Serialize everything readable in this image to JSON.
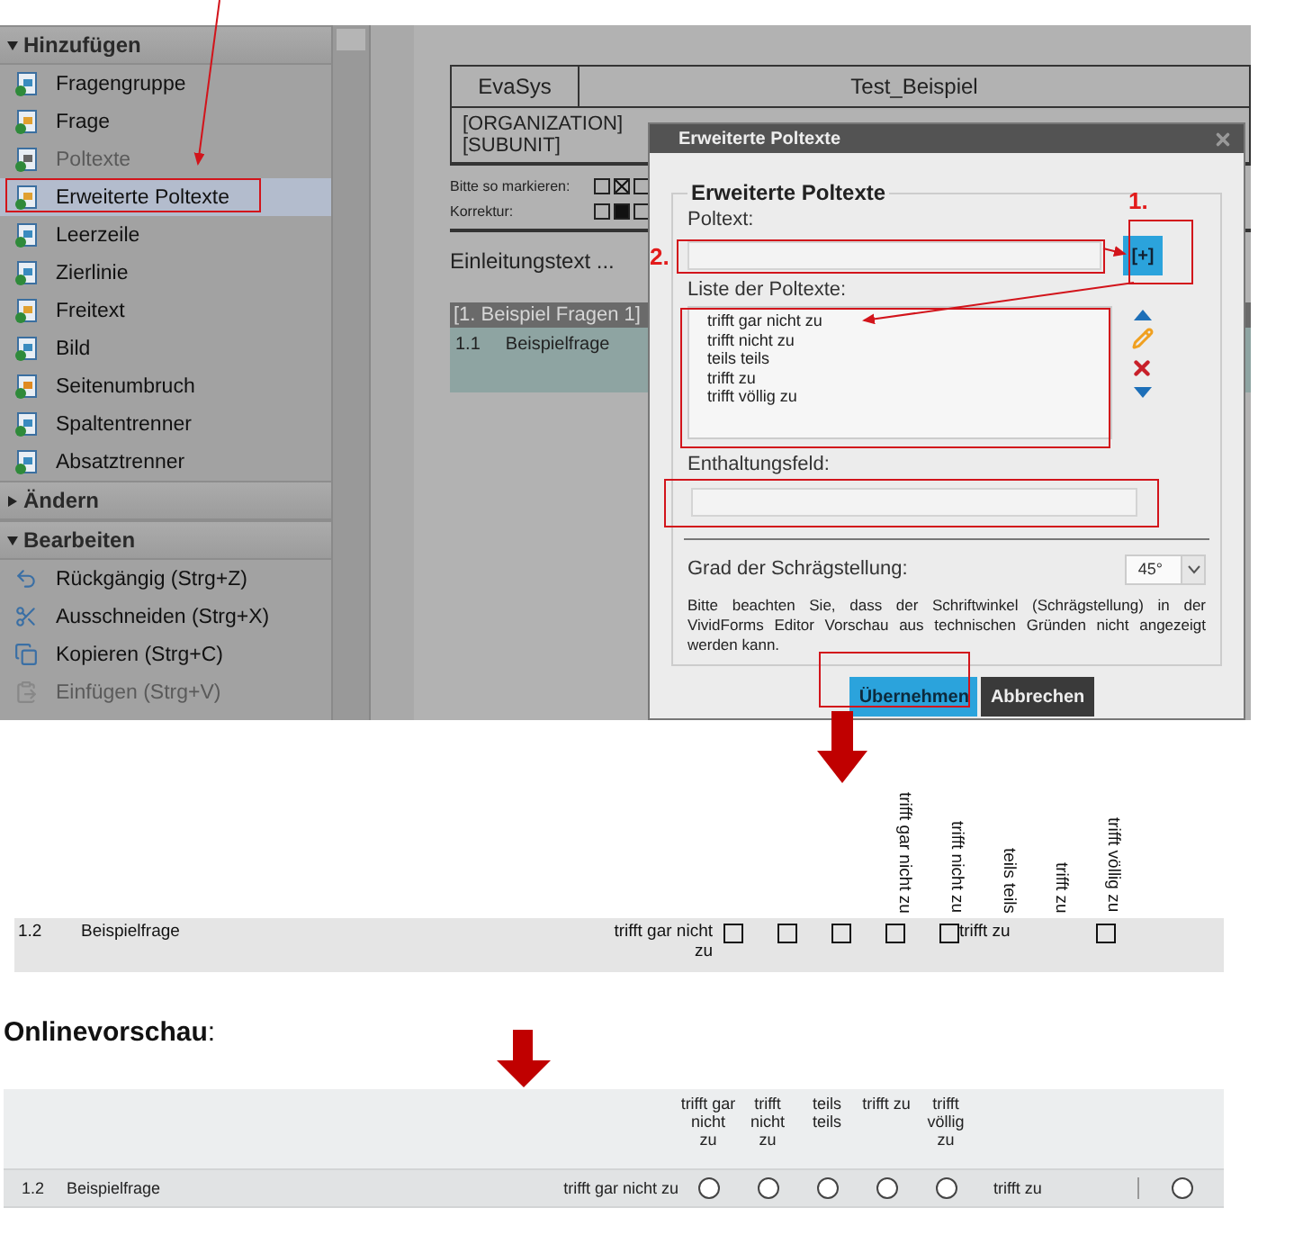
{
  "sidebar": {
    "sections": [
      {
        "title": "Hinzufügen",
        "expanded": true,
        "items": [
          {
            "label": "Fragengruppe",
            "disabled": false,
            "selected": false
          },
          {
            "label": "Frage",
            "disabled": false,
            "selected": false
          },
          {
            "label": "Poltexte",
            "disabled": true,
            "selected": false
          },
          {
            "label": "Erweiterte Poltexte",
            "disabled": false,
            "selected": true
          },
          {
            "label": "Leerzeile",
            "disabled": false,
            "selected": false
          },
          {
            "label": "Zierlinie",
            "disabled": false,
            "selected": false
          },
          {
            "label": "Freitext",
            "disabled": false,
            "selected": false
          },
          {
            "label": "Bild",
            "disabled": false,
            "selected": false
          },
          {
            "label": "Seitenumbruch",
            "disabled": false,
            "selected": false
          },
          {
            "label": "Spaltentrenner",
            "disabled": false,
            "selected": false
          },
          {
            "label": "Absatztrenner",
            "disabled": false,
            "selected": false
          }
        ]
      },
      {
        "title": "Ändern",
        "expanded": false
      },
      {
        "title": "Bearbeiten",
        "expanded": true,
        "items": [
          {
            "label": "Rückgängig (Strg+Z)",
            "disabled": false,
            "selected": false
          },
          {
            "label": "Ausschneiden (Strg+X)",
            "disabled": false,
            "selected": false
          },
          {
            "label": "Kopieren (Strg+C)",
            "disabled": false,
            "selected": false
          },
          {
            "label": "Einfügen (Strg+V)",
            "disabled": true,
            "selected": false
          }
        ]
      }
    ]
  },
  "document": {
    "header_left": "EvaSys",
    "header_right": "Test_Beispiel",
    "organization": "[ORGANIZATION]",
    "subunit": "[SUBUNIT]",
    "mark_rows": [
      {
        "label": "Bitte so markieren:",
        "boxes": [
          {
            "kind": "empty"
          },
          {
            "kind": "crossed"
          },
          {
            "kind": "empty"
          }
        ]
      },
      {
        "label": "Korrektur:",
        "boxes": [
          {
            "kind": "empty"
          },
          {
            "kind": "filled"
          },
          {
            "kind": "empty"
          }
        ]
      }
    ],
    "intro": "Einleitungstext ...",
    "group_title": "[1. Beispiel Fragen 1]",
    "question": {
      "number": "1.1",
      "text": "Beispielfrage"
    }
  },
  "dialog": {
    "title": "Erweiterte Poltexte",
    "section_title": "Erweiterte Poltexte",
    "poltext_label": "Poltext:",
    "add_button": "[+]",
    "list_label": "Liste der Poltexte:",
    "list_items": [
      "trifft gar nicht zu",
      "trifft nicht zu",
      "teils teils",
      "trifft zu",
      "trifft völlig zu"
    ],
    "abstain_label": "Enthaltungsfeld:",
    "angle_label": "Grad der Schrägstellung:",
    "angle_value": "45°",
    "note": "Bitte beachten Sie, dass der Schriftwinkel (Schrägstellung) in der VividForms Editor Vorschau aus technischen Gründen nicht angezeigt werden kann.",
    "buttons": [
      {
        "label": "Übernehmen",
        "kind": "primary"
      },
      {
        "label": "Abbrechen",
        "kind": "secondary"
      }
    ]
  },
  "annotations": [
    "1.",
    "2."
  ],
  "editor_preview": {
    "columns": [
      "trifft gar nicht zu",
      "trifft nicht zu",
      "teils teils",
      "trifft zu",
      "trifft völlig zu"
    ],
    "row": {
      "number": "1.2",
      "text": "Beispielfrage",
      "left_label": "trifft gar nicht zu",
      "right_label": "trifft zu",
      "boxes": [
        {
          "checked": false
        },
        {
          "checked": false
        },
        {
          "checked": false
        },
        {
          "checked": false
        },
        {
          "checked": false
        },
        {
          "checked": false
        }
      ]
    }
  },
  "online_preview": {
    "heading": "Onlinevorschau",
    "heading_suffix": ":",
    "columns": [
      "trifft gar nicht zu",
      "trifft nicht zu",
      "teils teils",
      "trifft zu",
      "trifft völlig zu"
    ],
    "row": {
      "number": "1.2",
      "text": "Beispielfrage",
      "left_label": "trifft gar nicht zu",
      "right_label": "trifft zu",
      "radios": [
        {
          "selected": false
        },
        {
          "selected": false
        },
        {
          "selected": false
        },
        {
          "selected": false
        },
        {
          "selected": false
        },
        {
          "selected": false
        }
      ]
    }
  }
}
